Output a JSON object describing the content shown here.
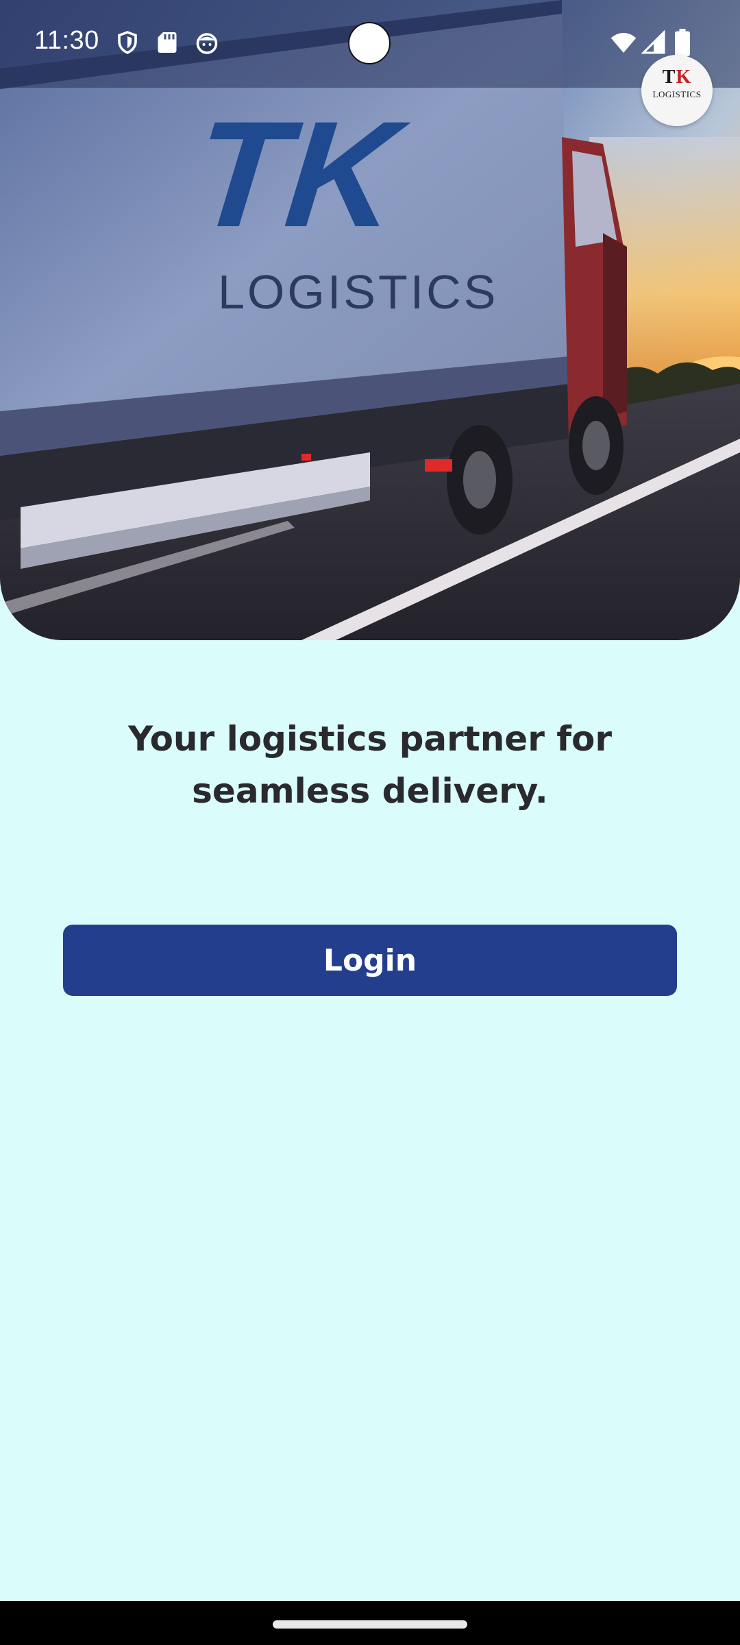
{
  "status_bar": {
    "time": "11:30",
    "icons": [
      "shield-icon",
      "sd-card-icon",
      "face-icon",
      "wifi-icon",
      "cellular-signal-icon",
      "battery-icon"
    ]
  },
  "hero": {
    "image": "truck-photo",
    "truck_brand_top": "TK",
    "truck_brand_bottom": "LOGISTICS"
  },
  "logo": {
    "letter_t": "T",
    "letter_k": "K",
    "text": "LOGISTICS"
  },
  "tagline": "Your logistics partner for seamless delivery.",
  "login_button": {
    "label": "Login"
  },
  "colors": {
    "background": "#dafcfb",
    "button": "#243e8e",
    "button_text": "#ffffff",
    "tagline": "#2a2a2e",
    "logo_k": "#c51f24"
  }
}
